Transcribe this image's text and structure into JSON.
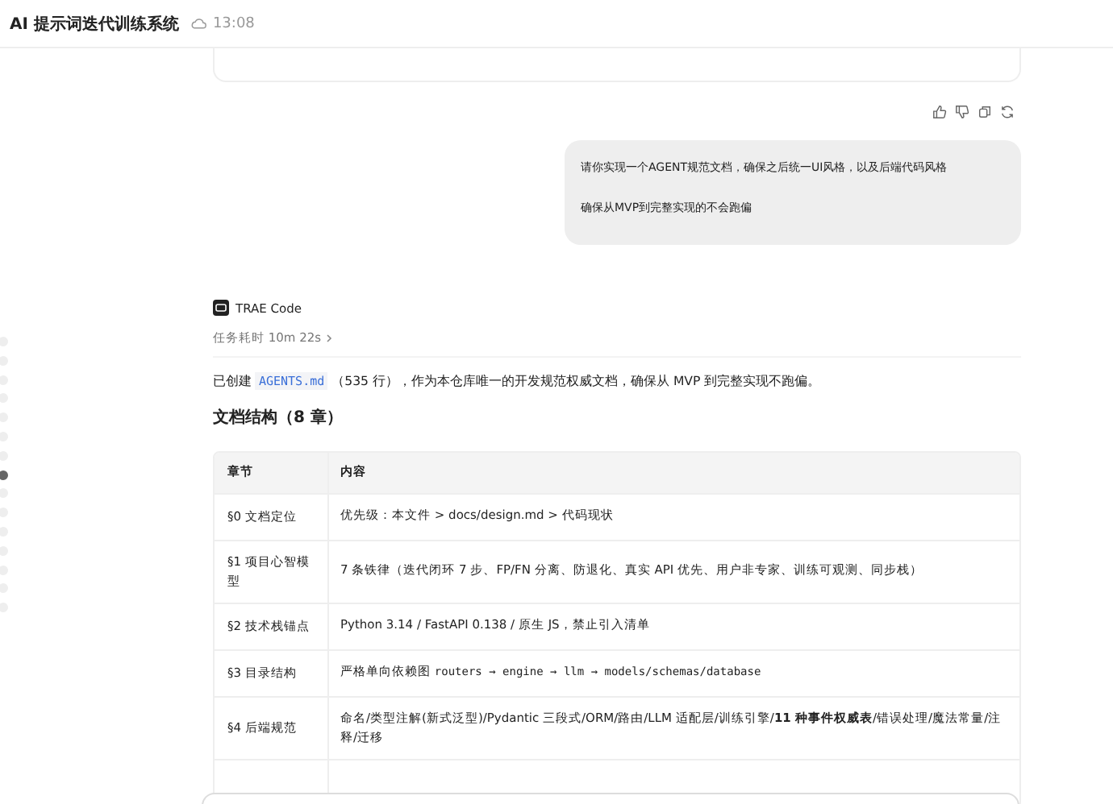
{
  "header": {
    "title": "AI 提示词迭代训练系统",
    "time": "13:08"
  },
  "nav_dots": [
    {
      "selected": false
    },
    {
      "selected": false
    },
    {
      "selected": false
    },
    {
      "selected": false
    },
    {
      "selected": false
    },
    {
      "selected": false
    },
    {
      "selected": false
    },
    {
      "selected": true
    },
    {
      "selected": false
    },
    {
      "selected": false
    },
    {
      "selected": false
    },
    {
      "selected": false
    },
    {
      "selected": false
    },
    {
      "selected": false
    },
    {
      "selected": false
    }
  ],
  "user_message": {
    "lines": [
      "请你实现一个AGENT规范文档，确保之后统一UI风格，以及后端代码风格",
      "确保从MVP到完整实现的不会跑偏"
    ]
  },
  "reply": {
    "agent": "TRAE Code",
    "duration": "任务耗时 10m 22s",
    "summary_before": "已创建",
    "file": "AGENTS.md",
    "summary_after": "（535 行），作为本仓库唯一的开发规范权威文档，确保从 MVP 到完整实现不跑偏。",
    "heading": "文档结构（8 章）",
    "table": {
      "columns": [
        "章节",
        "内容"
      ],
      "rows": [
        {
          "section": "§0 文档定位",
          "content": [
            {
              "kind": "text",
              "text": "优先级：本文件 > docs/design.md > 代码现状"
            }
          ]
        },
        {
          "section": "§1 项目心智模型",
          "content": [
            {
              "kind": "text",
              "text": "7 条铁律（迭代闭环 7 步、FP/FN 分离、防退化、真实 API 优先、用户非专家、训练可观测、同步栈）"
            }
          ]
        },
        {
          "section": "§2 技术栈锚点",
          "content": [
            {
              "kind": "text",
              "text": "Python 3.14 / FastAPI 0.138 / 原生 JS，禁止引入清单"
            }
          ]
        },
        {
          "section": "§3 目录结构",
          "content": [
            {
              "kind": "text",
              "text": "严格单向依赖图 "
            },
            {
              "kind": "code",
              "text": "routers → engine → llm → models/schemas/database"
            }
          ]
        },
        {
          "section": "§4 后端规范",
          "content": [
            {
              "kind": "rich",
              "text": "命名/类型注解(新式泛型)/Pydantic 三段式/ORM/路由/LLM 适配层/训练引擎/**11 种事件权威表**/错误处理/魔法常量/注释/迁移"
            }
          ]
        }
      ]
    }
  }
}
